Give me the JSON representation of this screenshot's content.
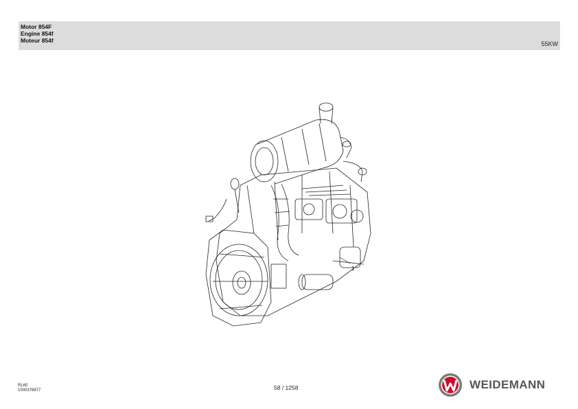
{
  "header": {
    "title_de": "Motor 854F",
    "title_en": "Engine 854f",
    "title_fr": "Moteur 854f",
    "power": "55KW"
  },
  "drawing": {
    "callout": "1"
  },
  "footer": {
    "model": "RL60",
    "doc_number": "1000376877",
    "page": "58 / 1258",
    "brand": "WEIDEMANN",
    "logo_icon": "weidemann-w-logo-icon"
  },
  "colors": {
    "header_bg": "#dcdcdc",
    "logo_red": "#c8102e",
    "logo_grey": "#7a7a7a"
  }
}
